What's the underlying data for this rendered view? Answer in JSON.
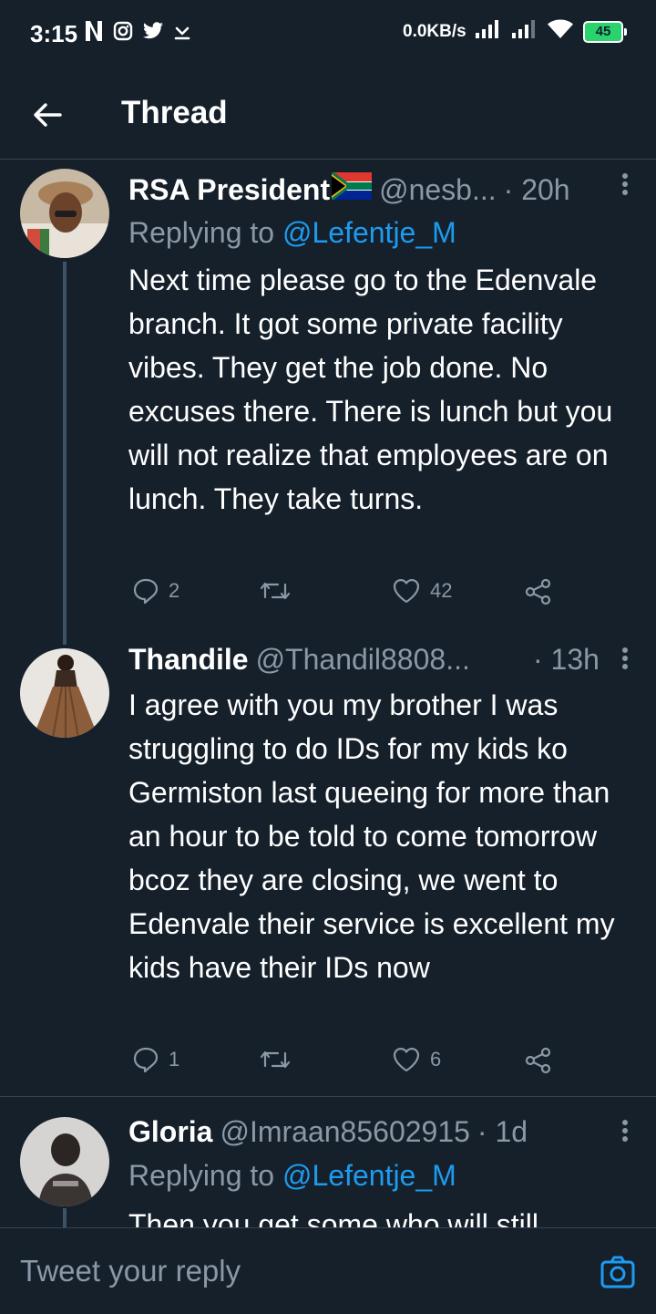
{
  "status_bar": {
    "time": "3:15",
    "net_speed": "0.0KB/s",
    "battery": "45",
    "icons": [
      "netflix-icon",
      "instagram-icon",
      "twitter-icon",
      "download-icon",
      "signal-icon",
      "signal-icon",
      "wifi-icon",
      "battery-icon"
    ]
  },
  "header": {
    "title": "Thread",
    "back_icon": "arrow-left-icon"
  },
  "tweets": [
    {
      "name": "RSA President",
      "handle": "@nesb...",
      "time": "· 20h",
      "replying_prefix": "Replying to ",
      "replying_to": "@Lefentje_M",
      "body": "Next time please go to the Edenvale branch. It got some private facility vibes. They get the job done. No excuses there. There is lunch but you will not realize that employees are on lunch. They take turns.",
      "replies": "2",
      "retweets": "",
      "likes": "42"
    },
    {
      "name": "Thandile",
      "handle": "@Thandil8808...",
      "time": "· 13h",
      "body": "I agree with you my brother I was struggling  to do IDs for my kids ko Germiston last  queeing for more than an hour to be told to come tomorrow bcoz they are closing, we went to Edenvale  their service is excellent my kids have their IDs now",
      "replies": "1",
      "retweets": "",
      "likes": "6"
    },
    {
      "name": "Gloria",
      "handle": "@Imraan85602915",
      "time": "· 1d",
      "replying_prefix": "Replying to ",
      "replying_to": "@Lefentje_M",
      "body": "Then you get some who will still"
    }
  ],
  "reply_bar": {
    "placeholder": "Tweet your reply"
  },
  "colors": {
    "background": "#15202b",
    "accent": "#1d9bf0",
    "muted": "#8b98a5",
    "divider": "#38444d"
  }
}
